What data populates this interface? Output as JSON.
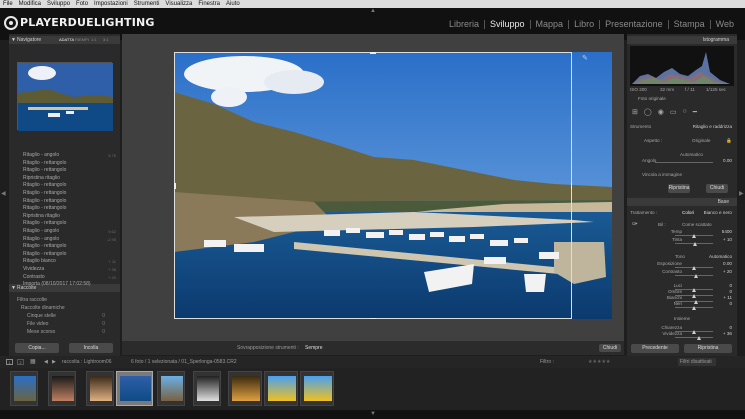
{
  "menubar": [
    "File",
    "Modifica",
    "Sviluppo",
    "Foto",
    "Impostazioni",
    "Strumenti",
    "Visualizza",
    "Finestra",
    "Aiuto"
  ],
  "brand": {
    "name": "PLAYERDUELIGHTING"
  },
  "modules": [
    "Libreria",
    "Sviluppo",
    "Mappa",
    "Libro",
    "Presentazione",
    "Stampa",
    "Web"
  ],
  "active_module": "Sviluppo",
  "left": {
    "navigator_title": "Navigatore",
    "nav_opts": [
      "ADATTA",
      "RIEMPI",
      "1:1",
      "3:1"
    ],
    "history": [
      {
        "label": "Ritaglio - angolo",
        "value": "5.76"
      },
      {
        "label": "Ritaglio - rettangolo",
        "value": ""
      },
      {
        "label": "Ritaglio - rettangolo",
        "value": ""
      },
      {
        "label": "Ripristina ritaglio",
        "value": ""
      },
      {
        "label": "Ritaglio - rettangolo",
        "value": ""
      },
      {
        "label": "Ritaglio - rettangolo",
        "value": ""
      },
      {
        "label": "Ritaglio - rettangolo",
        "value": ""
      },
      {
        "label": "Ritaglio - rettangolo",
        "value": ""
      },
      {
        "label": "Ripristina ritaglio",
        "value": ""
      },
      {
        "label": "Ritaglio - rettangolo",
        "value": ""
      },
      {
        "label": "Ritaglio - angolo",
        "value": "9.62"
      },
      {
        "label": "Ritaglio - angolo",
        "value": "-2.95"
      },
      {
        "label": "Ritaglio - rettangolo",
        "value": ""
      },
      {
        "label": "Ritaglio - rettangolo",
        "value": ""
      },
      {
        "label": "Ritaglio bianco",
        "value": "+ 11"
      },
      {
        "label": "Vividezza",
        "value": "+ 36"
      },
      {
        "label": "Contrasto",
        "value": "+ 20"
      },
      {
        "label": "Importa (08/10/2017 17:02:58)",
        "value": ""
      }
    ],
    "collections_title": "Raccolte",
    "collections": [
      "Filtra raccolte",
      "Raccolte dinamiche",
      "Cinque stelle",
      "File video",
      "Mese scorso"
    ],
    "collection_counts": [
      "",
      "",
      "0",
      "0",
      "0"
    ],
    "copy_btn": "Copia...",
    "paste_btn": "Incolla"
  },
  "center": {
    "toolbar_label": "Sovrapposizione strumenti :",
    "toolbar_value": "Sempre",
    "done_btn": "Chiudi"
  },
  "right": {
    "histogram_title": "Istogramma",
    "exif": [
      "ISO 200",
      "32 mm",
      "f / 11",
      "1/125 sec"
    ],
    "original_photo": "Foto originale",
    "tool_title": "Strumento",
    "tool_value": "Ritaglio e raddrizza",
    "aspect_label": "Aspetto :",
    "aspect_value": "Originale",
    "auto_label": "Automatico",
    "angle_label": "Angolo",
    "angle_value": "0.00",
    "constrain_label": "Vincola a immagine",
    "reset_btn": "Ripristina",
    "close_btn": "Chiudi",
    "base_title": "Base",
    "treatment_label": "Trattamento :",
    "treatment_color": "Colori",
    "treatment_bw": "Bianco e nero",
    "wb_label": "Bil :",
    "wb_value": "Come scattato",
    "sliders": [
      {
        "label": "Temp",
        "value": "5400"
      },
      {
        "label": "Tinta",
        "value": "+ 10"
      },
      {
        "label": "Esposizione",
        "value": "0.00"
      },
      {
        "label": "Contrasto",
        "value": "+ 20"
      },
      {
        "label": "Luci",
        "value": "0"
      },
      {
        "label": "Ombre",
        "value": "0"
      },
      {
        "label": "Bianchi",
        "value": "+ 11"
      },
      {
        "label": "Neri",
        "value": "0"
      },
      {
        "label": "Chiarezza",
        "value": "0"
      },
      {
        "label": "Vividezza",
        "value": "+ 36"
      }
    ],
    "tone_label": "Tono",
    "tone_auto": "Automatico",
    "presence_label": "Insieme",
    "prev_btn": "Precedente",
    "reset2_btn": "Ripristina"
  },
  "filmstrip": {
    "pages": [
      "1",
      "2"
    ],
    "source": "raccolta : Lightroom06",
    "count": "6 foto / 1 selezionata / 01_Sperlonga-0583.CR2",
    "filter_label": "Filtro :",
    "filter_value": "Filtri disattivati",
    "selected_index": 3
  }
}
